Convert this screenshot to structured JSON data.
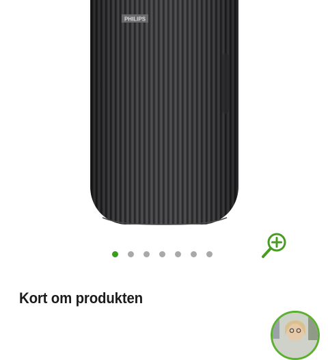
{
  "product": {
    "brand_logo_text": "PHILIPS",
    "image_icon": "speaker-product-photo"
  },
  "gallery": {
    "image_count": 7,
    "active_index": 0,
    "zoom_icon": "zoom-in-icon",
    "active_color": "#3c9c1c",
    "inactive_color": "#a9a9a9"
  },
  "section": {
    "title": "Kort om produkten"
  },
  "advisor": {
    "avatar_icon": "advisor-avatar",
    "ring_color": "#5cb030"
  }
}
